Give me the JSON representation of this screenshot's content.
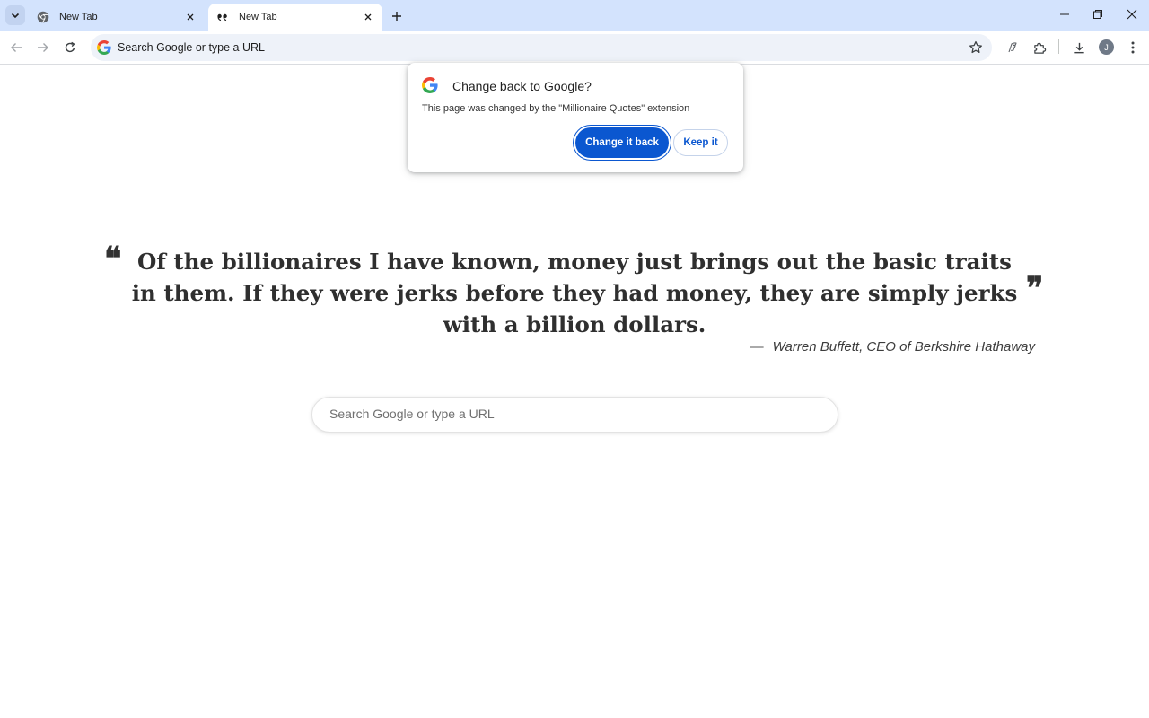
{
  "tabs": [
    {
      "title": "New Tab",
      "favicon": "chrome-icon",
      "active": false
    },
    {
      "title": "New Tab",
      "favicon": "quote-icon",
      "active": true
    }
  ],
  "toolbar": {
    "omnibox_text": "Search Google or type a URL",
    "profile_initial": "J"
  },
  "popup": {
    "title": "Change back to Google?",
    "body": "This page was changed by the \"Millionaire Quotes\" extension",
    "primary_button": "Change it back",
    "secondary_button": "Keep it"
  },
  "quote": {
    "open_mark": "❝",
    "close_mark": "❞",
    "text": "Of the billionaires I have known, money just brings out the basic traits in them. If they were jerks before they had money, they are simply jerks with a billion dollars.",
    "author_dash": "—",
    "author": "Warren Buffett, CEO of Berkshire Hathaway"
  },
  "search": {
    "placeholder": "Search Google or type a URL"
  },
  "colors": {
    "tabstrip": "#d3e3fd",
    "accent": "#0b57d0",
    "omnibox": "#eef2f9"
  }
}
